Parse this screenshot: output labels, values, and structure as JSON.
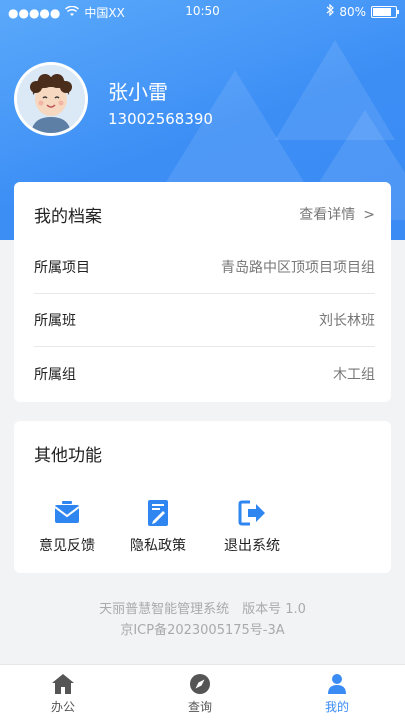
{
  "status_bar": {
    "carrier": "中国XX",
    "time": "10:50",
    "battery": "80%"
  },
  "profile": {
    "name": "张小雷",
    "phone": "13002568390"
  },
  "archive": {
    "title": "我的档案",
    "detail_link": "查看详情",
    "detail_chevron": ">",
    "rows": [
      {
        "label": "所属项目",
        "value": "青岛路中区顶项目项目组"
      },
      {
        "label": "所属班",
        "value": "刘长林班"
      },
      {
        "label": "所属组",
        "value": "木工组"
      }
    ]
  },
  "functions": {
    "title": "其他功能",
    "items": [
      {
        "label": "意见反馈",
        "icon": "feedback-envelope-icon"
      },
      {
        "label": "隐私政策",
        "icon": "privacy-document-icon"
      },
      {
        "label": "退出系统",
        "icon": "logout-icon"
      }
    ]
  },
  "footer": {
    "line1": "天丽普慧智能管理系统　版本号 1.0",
    "line2": "京ICP备2023005175号-3A"
  },
  "tabbar": {
    "items": [
      {
        "label": "办公",
        "icon": "home-icon",
        "active": false
      },
      {
        "label": "查询",
        "icon": "compass-icon",
        "active": false
      },
      {
        "label": "我的",
        "icon": "person-icon",
        "active": true
      }
    ]
  },
  "colors": {
    "accent": "#3a8bf4",
    "header_gradient_start": "#5aa9fb",
    "icon_blue": "#2f86f0"
  }
}
